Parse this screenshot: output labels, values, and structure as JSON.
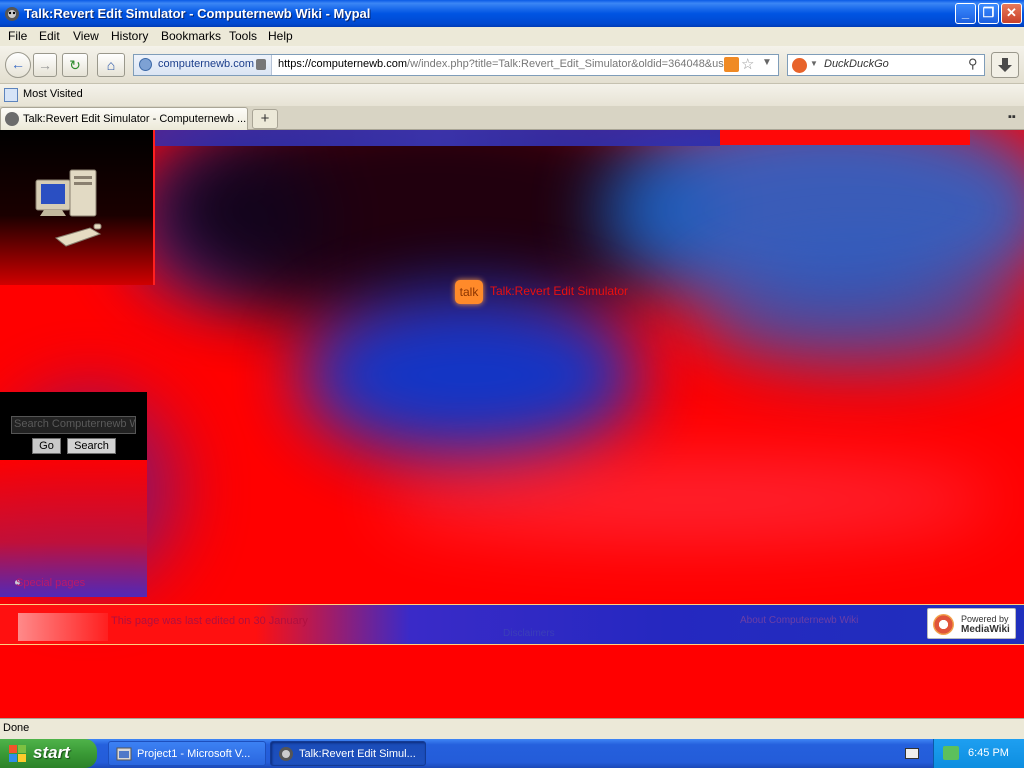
{
  "window": {
    "title": "Talk:Revert Edit Simulator - Computernewb Wiki - Mypal",
    "minimize": "_",
    "maximize": "❐",
    "close": "✕"
  },
  "menu": [
    "File",
    "Edit",
    "View",
    "History",
    "Bookmarks",
    "Tools",
    "Help"
  ],
  "nav": {
    "back": "←",
    "forward": "→",
    "reload": "↻",
    "home": "⌂",
    "identity_domain": "computernewb.com",
    "url_prefix": "https://computernewb.com",
    "url_rest": "/w/index.php?title=Talk:Revert_Edit_Simulator&oldid=364048&us",
    "search_placeholder": "DuckDuckGo"
  },
  "bookmarks": {
    "most_visited": "Most Visited"
  },
  "tabs": [
    {
      "label": "Talk:Revert Edit Simulator - Computernewb ..."
    }
  ],
  "tab_new": "+",
  "page": {
    "talk_tab": "talk",
    "talk_title": "Talk:Revert Edit Simulator",
    "search_placeholder": "Search Computernewb Wiki",
    "go_label": "Go",
    "search_label": "Search",
    "sidebar_link": "Special pages",
    "footer_edited": "This page was last edited on 30 January",
    "footer_link1": "Disclaimers",
    "footer_link2": "About Computernewb Wiki",
    "powered_by_line1": "Powered by",
    "powered_by_line2": "MediaWiki"
  },
  "status": {
    "text": "Done"
  },
  "taskbar": {
    "start": "start",
    "tasks": [
      {
        "label": "Project1 - Microsoft V..."
      },
      {
        "label": "Talk:Revert Edit Simul..."
      }
    ],
    "clock": "6:45 PM"
  }
}
